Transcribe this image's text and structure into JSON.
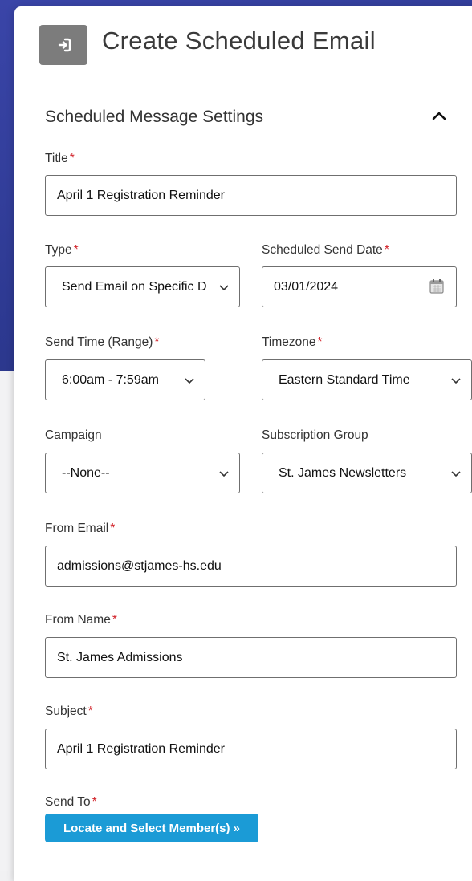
{
  "header": {
    "title": "Create Scheduled Email"
  },
  "section": {
    "title": "Scheduled Message Settings"
  },
  "form": {
    "title": {
      "label": "Title",
      "value": "April 1 Registration Reminder"
    },
    "type": {
      "label": "Type",
      "value": "Send Email on Specific D"
    },
    "send_date": {
      "label": "Scheduled Send Date",
      "value": "03/01/2024"
    },
    "send_time": {
      "label": "Send Time (Range)",
      "value": "6:00am - 7:59am"
    },
    "timezone": {
      "label": "Timezone",
      "value": "Eastern Standard Time"
    },
    "campaign": {
      "label": "Campaign",
      "value": "--None--"
    },
    "subscription_group": {
      "label": "Subscription Group",
      "value": "St. James Newsletters"
    },
    "from_email": {
      "label": "From Email",
      "value": "admissions@stjames-hs.edu"
    },
    "from_name": {
      "label": "From Name",
      "value": "St. James Admissions"
    },
    "subject": {
      "label": "Subject",
      "value": "April 1 Registration Reminder"
    },
    "send_to": {
      "label": "Send To",
      "button": "Locate and Select Member(s) »"
    }
  },
  "required_marker": "*",
  "colors": {
    "accent_button": "#1b9bd6",
    "required": "#d2232a",
    "backdrop": "#2d3991"
  }
}
